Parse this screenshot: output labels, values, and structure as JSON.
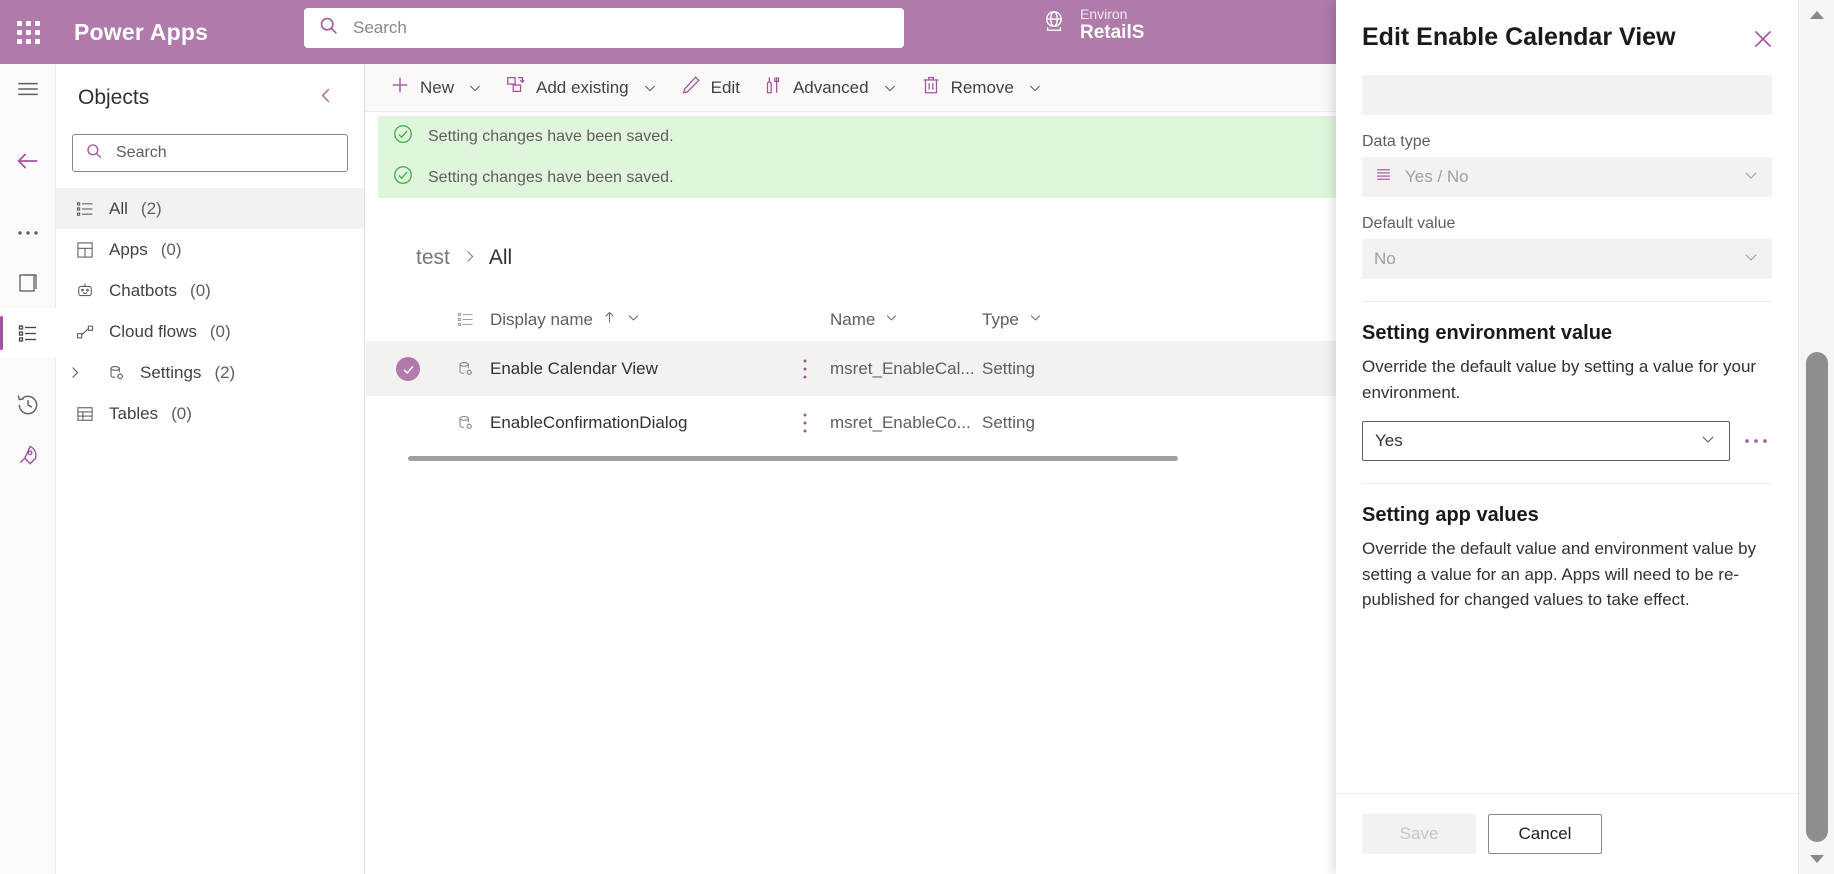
{
  "topbar": {
    "waffle_icon": "app-launcher-icon",
    "brand": "Power Apps",
    "search_placeholder": "Search",
    "search_value": "",
    "search_icon": "search-icon",
    "globe_icon": "globe-icon",
    "environment_label": "Environ",
    "environment_name": "RetailS"
  },
  "rail": {
    "items": [
      {
        "name": "hamburger-icon",
        "selected": false
      },
      {
        "name": "back-arrow-icon",
        "selected": false
      },
      {
        "name": "ellipsis-icon",
        "selected": false
      },
      {
        "name": "pages-icon",
        "selected": false
      },
      {
        "name": "objects-list-icon",
        "selected": true
      },
      {
        "name": "history-icon",
        "selected": false
      },
      {
        "name": "rocket-icon",
        "selected": false
      }
    ]
  },
  "objects": {
    "title": "Objects",
    "collapse_icon": "chevron-left-icon",
    "search_placeholder": "Search",
    "search_value": "",
    "items": [
      {
        "icon": "list-icon",
        "label": "All",
        "count": "(2)",
        "active": true,
        "expandable": false
      },
      {
        "icon": "grid-app-icon",
        "label": "Apps",
        "count": "(0)",
        "active": false,
        "expandable": false
      },
      {
        "icon": "chatbot-icon",
        "label": "Chatbots",
        "count": "(0)",
        "active": false,
        "expandable": false
      },
      {
        "icon": "cloudflow-icon",
        "label": "Cloud flows",
        "count": "(0)",
        "active": false,
        "expandable": false
      },
      {
        "icon": "settings-icon",
        "label": "Settings",
        "count": "(2)",
        "active": false,
        "expandable": true
      },
      {
        "icon": "table-icon",
        "label": "Tables",
        "count": "(0)",
        "active": false,
        "expandable": false
      }
    ]
  },
  "commandbar": {
    "items": [
      {
        "icon": "plus-icon",
        "label": "New",
        "has_chevron": true
      },
      {
        "icon": "add-existing-icon",
        "label": "Add existing",
        "has_chevron": true
      },
      {
        "icon": "pencil-icon",
        "label": "Edit",
        "has_chevron": false
      },
      {
        "icon": "advanced-icon",
        "label": "Advanced",
        "has_chevron": true
      },
      {
        "icon": "trash-icon",
        "label": "Remove",
        "has_chevron": true
      }
    ]
  },
  "notifications": [
    {
      "icon": "success-check-icon",
      "text": "Setting changes have been saved."
    },
    {
      "icon": "success-check-icon",
      "text": "Setting changes have been saved."
    }
  ],
  "breadcrumb": {
    "parent": "test",
    "separator_icon": "chevron-right-icon",
    "current": "All"
  },
  "table": {
    "columns": [
      {
        "key": "select",
        "label": "",
        "sort_icon": "",
        "has_menu": false
      },
      {
        "key": "icon",
        "label": "",
        "sort_icon": "list-icon",
        "has_menu": false
      },
      {
        "key": "display",
        "label": "Display name",
        "sort_icon": "arrow-up-icon",
        "has_menu": true
      },
      {
        "key": "name",
        "label": "Name",
        "sort_icon": "",
        "has_menu": true
      },
      {
        "key": "type",
        "label": "Type",
        "sort_icon": "",
        "has_menu": true
      }
    ],
    "rows": [
      {
        "selected": true,
        "row_icon": "setting-entity-icon",
        "display_name": "Enable Calendar View",
        "overflow_icon": "vertical-ellipsis-icon",
        "name": "msret_EnableCal...",
        "type": "Setting"
      },
      {
        "selected": false,
        "row_icon": "setting-entity-icon",
        "display_name": "EnableConfirmationDialog",
        "overflow_icon": "vertical-ellipsis-icon",
        "name": "msret_EnableCo...",
        "type": "Setting"
      }
    ]
  },
  "panel": {
    "title": "Edit Enable Calendar View",
    "close_icon": "close-icon",
    "blank_field_value": "",
    "data_type": {
      "label": "Data type",
      "icon": "list-lines-icon",
      "value": "Yes / No",
      "chevron_icon": "chevron-down-icon"
    },
    "default_value": {
      "label": "Default value",
      "value": "No",
      "chevron_icon": "chevron-down-icon"
    },
    "environment_section": {
      "title": "Setting environment value",
      "description": "Override the default value by setting a value for your environment.",
      "value": "Yes",
      "chevron_icon": "chevron-down-icon",
      "more_icon": "ellipsis-icon"
    },
    "app_section": {
      "title": "Setting app values",
      "description": "Override the default value and environment value by setting a value for an app. Apps will need to be re-published for changed values to take effect."
    },
    "footer": {
      "save_label": "Save",
      "cancel_label": "Cancel"
    }
  },
  "scrollbar": {
    "up_icon": "scroll-up-icon",
    "down_icon": "scroll-down-icon"
  },
  "colors": {
    "brand_purple": "#b07aab",
    "accent_purple": "#a4539e",
    "success_green": "#dff6dd",
    "selected_row": "#f3f2f1"
  }
}
